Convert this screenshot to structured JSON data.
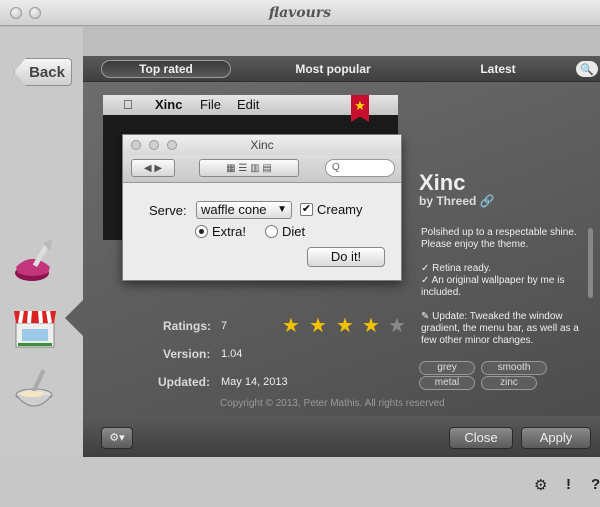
{
  "app": {
    "title": "flavours"
  },
  "nav": {
    "back_label": "Back"
  },
  "tabs": [
    {
      "label": "Top rated",
      "active": true
    },
    {
      "label": "Most popular",
      "active": false
    },
    {
      "label": "Latest",
      "active": false
    }
  ],
  "preview": {
    "menubar": {
      "apple": "",
      "app_name": "Xinc",
      "menus": [
        "File",
        "Edit"
      ]
    },
    "dialog": {
      "title": "Xinc",
      "search_placeholder": "Q",
      "serve_label": "Serve:",
      "serve_value": "waffle cone",
      "creamy_label": "Creamy",
      "creamy_checked": true,
      "extra_label": "Extra!",
      "diet_label": "Diet",
      "selected_radio": "Extra!",
      "doit_label": "Do it!"
    }
  },
  "theme": {
    "name": "Xinc",
    "by": "by Threed",
    "description": [
      "Polsihed up to a respectable shine. Please enjoy the theme.",
      "✓ Retina ready.\n✓ An original wallpaper by me is included.",
      "✎ Update: Tweaked the window gradient, the menu bar, as well as a few other minor changes."
    ],
    "ratings_label": "Ratings:",
    "ratings_value": "7",
    "stars": 4,
    "stars_max": 5,
    "version_label": "Version:",
    "version_value": "1.04",
    "updated_label": "Updated:",
    "updated_value": "May 14, 2013",
    "tags": [
      "grey",
      "smooth",
      "metal",
      "zinc"
    ],
    "copyright": "Copyright © 2013, Peter Mathis. All rights reserved"
  },
  "actions": {
    "gear": "⚙▾",
    "close": "Close",
    "apply": "Apply"
  },
  "footer": {
    "settings": "⚙",
    "alert": "!",
    "help": "?"
  }
}
